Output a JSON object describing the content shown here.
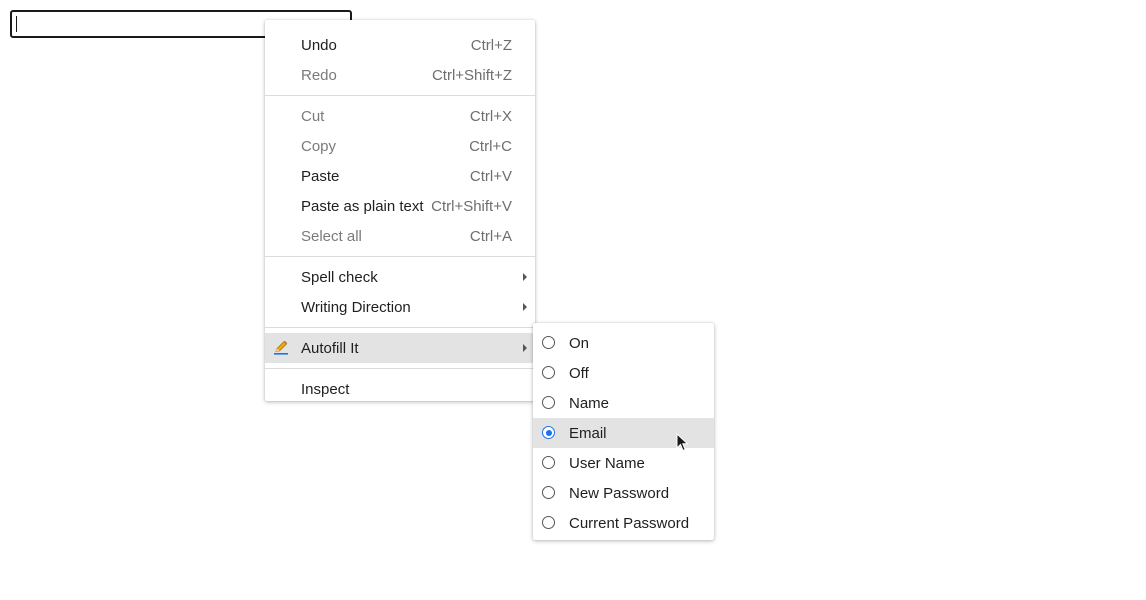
{
  "context_menu": {
    "items": [
      {
        "label": "Undo",
        "shortcut": "Ctrl+Z"
      },
      {
        "label": "Redo",
        "shortcut": "Ctrl+Shift+Z"
      },
      {
        "label": "Cut",
        "shortcut": "Ctrl+X"
      },
      {
        "label": "Copy",
        "shortcut": "Ctrl+C"
      },
      {
        "label": "Paste",
        "shortcut": "Ctrl+V"
      },
      {
        "label": "Paste as plain text",
        "shortcut": "Ctrl+Shift+V"
      },
      {
        "label": "Select all",
        "shortcut": "Ctrl+A"
      },
      {
        "label": "Spell check"
      },
      {
        "label": "Writing Direction"
      },
      {
        "label": "Autofill It",
        "icon": "pencil-icon"
      },
      {
        "label": "Inspect"
      }
    ]
  },
  "autofill_submenu": {
    "options": [
      "On",
      "Off",
      "Name",
      "Email",
      "User Name",
      "New Password",
      "Current Password"
    ],
    "selected": "Email"
  },
  "colors": {
    "accent": "#1a73e8",
    "highlight": "#e3e3e3",
    "disabled_text": "#7a7a7a"
  }
}
